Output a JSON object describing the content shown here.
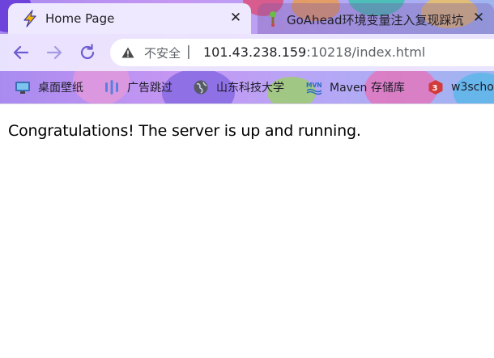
{
  "browser": {
    "tabs": [
      {
        "title": "Home Page",
        "active": true,
        "favicon": "lightning-icon"
      },
      {
        "title": "GoAhead环境变量注入复现踩坑",
        "active": false,
        "favicon": "pin-icon"
      }
    ],
    "close_symbol": "✕",
    "toolbar": {
      "back_icon": "arrow-left-icon",
      "forward_icon": "arrow-right-icon",
      "reload_icon": "reload-icon",
      "security_label": "不安全",
      "separator": "|",
      "url_host": "101.43.238.159",
      "url_rest": ":10218/index.html"
    },
    "bookmarks": [
      {
        "label": "桌面壁纸",
        "icon": "monitor-icon"
      },
      {
        "label": "广告跳过",
        "icon": "bars-icon"
      },
      {
        "label": "山东科技大学",
        "icon": "globe-icon"
      },
      {
        "label": "Maven 存储库",
        "icon": "maven-icon"
      },
      {
        "label": "w3scho",
        "icon": "w3school-icon"
      }
    ],
    "colors": {
      "theme_purple": "#a98bf0",
      "active_tab": "#efe9ff",
      "accent_icon": "#6d5bd0"
    }
  },
  "page": {
    "message": "Congratulations! The server is up and running."
  }
}
